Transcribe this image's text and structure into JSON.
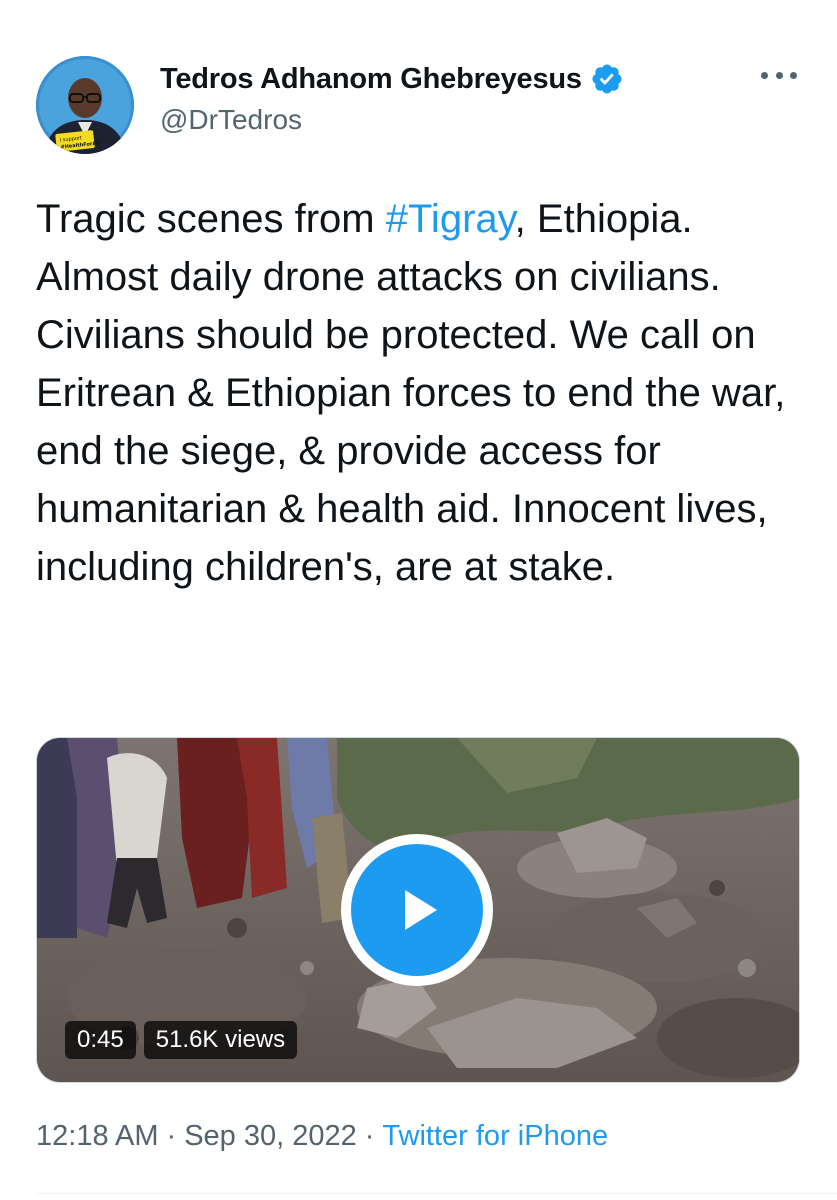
{
  "author": {
    "display_name": "Tedros Adhanom Ghebreyesus",
    "handle": "@DrTedros",
    "verified": true,
    "avatar_badge": [
      "I support",
      "#HealthForAll"
    ]
  },
  "tweet": {
    "text_before_hashtag": "Tragic scenes from ",
    "hashtag": "#Tigray",
    "text_after_hashtag": ", Ethiopia. Almost daily drone attacks on civilians. Civilians should be protected. We call on Eritrean & Ethiopian forces to end the war, end the siege, & provide access for humanitarian & health aid. Innocent lives, including children's, are at stake."
  },
  "video": {
    "duration": "0:45",
    "views": "51.6K views"
  },
  "meta": {
    "time": "12:18 AM",
    "date": "Sep 30, 2022",
    "source": "Twitter for iPhone",
    "separator": "·"
  },
  "icons": {
    "more": "more-horizontal-icon",
    "verified": "verified-badge-icon",
    "play": "play-icon"
  },
  "colors": {
    "accent": "#1d9bf0",
    "secondary_text": "#536471",
    "primary_text": "#0f1419"
  }
}
